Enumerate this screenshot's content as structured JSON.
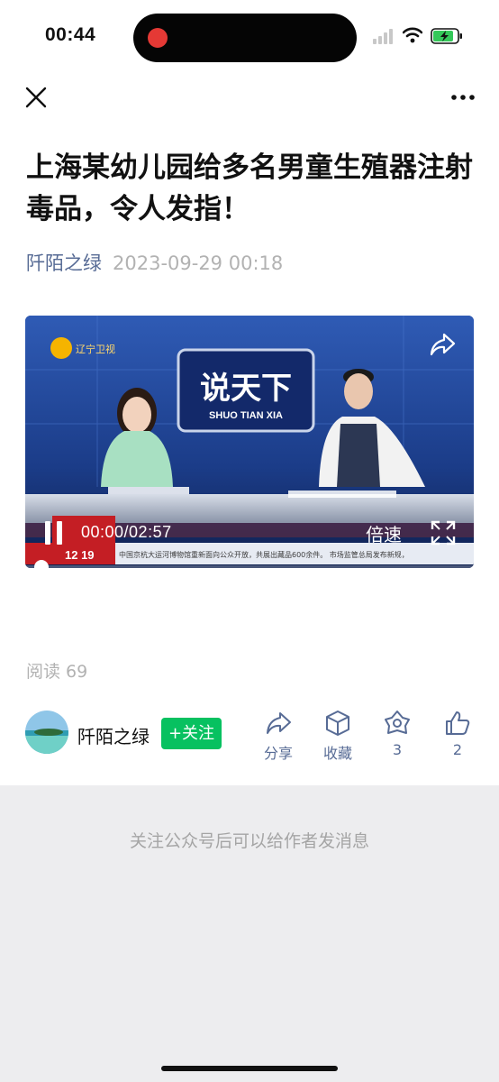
{
  "status_bar": {
    "time": "00:44",
    "icons": [
      "record-indicator",
      "signal-icon",
      "wifi-icon",
      "battery-charging-icon"
    ]
  },
  "nav": {
    "close_icon": "close-icon",
    "more_icon": "more-icon"
  },
  "article": {
    "title": "上海某幼儿园给多名男童生殖器注射毒品，令人发指！",
    "author": "阡陌之绿",
    "date": "2023-09-29 00:18"
  },
  "video": {
    "channel_logo_text": "辽宁卫视",
    "show_title": "说天下",
    "show_subtitle": "SHUO TIAN XIA",
    "ticker_time": "12 19",
    "ticker_text": "中国京杭大运河博物馆重新面向公众开放，共展出藏品600余件。    市场监管总局发布新规，",
    "current_time": "00:00/02:57",
    "speed_label": "倍速",
    "progress": 0.0
  },
  "stats": {
    "reads_label": "阅读 69"
  },
  "author_bar": {
    "name": "阡陌之绿",
    "follow_label": "+关注",
    "actions": [
      {
        "icon": "share-icon",
        "label": "分享"
      },
      {
        "icon": "favorite-icon",
        "label": "收藏"
      },
      {
        "icon": "wow-icon",
        "label": "3"
      },
      {
        "icon": "like-icon",
        "label": "2"
      }
    ]
  },
  "footer": {
    "hint": "关注公众号后可以给作者发消息"
  },
  "colors": {
    "accent_green": "#07c160",
    "link_blue": "#576b95",
    "muted_gray": "#b2b2b2",
    "record_red": "#e53935"
  }
}
